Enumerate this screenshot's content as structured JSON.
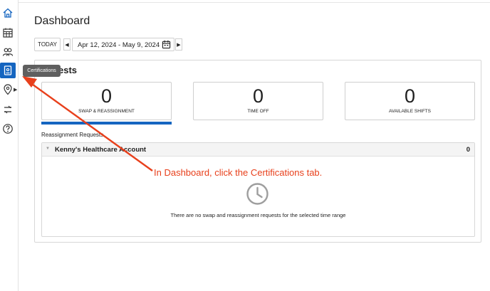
{
  "sidebar": {
    "items": [
      {
        "icon": "home-icon"
      },
      {
        "icon": "calendar-grid-icon"
      },
      {
        "icon": "people-icon"
      },
      {
        "icon": "certifications-icon",
        "active": true
      },
      {
        "icon": "location-pin-icon"
      },
      {
        "icon": "swap-icon"
      },
      {
        "icon": "help-icon"
      }
    ],
    "tooltip": "Certifications"
  },
  "page": {
    "title": "Dashboard"
  },
  "date_controls": {
    "today_label": "TODAY",
    "prev_label": "◀",
    "next_label": "▶",
    "range": "Apr 12, 2024 - May 9, 2024"
  },
  "requests_panel": {
    "title": "ests",
    "cards": [
      {
        "count": "0",
        "label": "SWAP & REASSIGNMENT",
        "selected": true
      },
      {
        "count": "0",
        "label": "TIME OFF"
      },
      {
        "count": "0",
        "label": "AVAILABLE SHIFTS"
      }
    ],
    "section_label": "Reassignment Requests",
    "account": {
      "name": "Kenny's Healthcare Account",
      "count": "0"
    },
    "empty_message": "There are no swap and reassignment requests for the selected time range"
  },
  "annotation": {
    "text": "In Dashboard, click the Certifications tab.",
    "color": "#e8401c"
  },
  "colors": {
    "accent": "#1565c0",
    "tooltip_bg": "#5f5f5f"
  }
}
